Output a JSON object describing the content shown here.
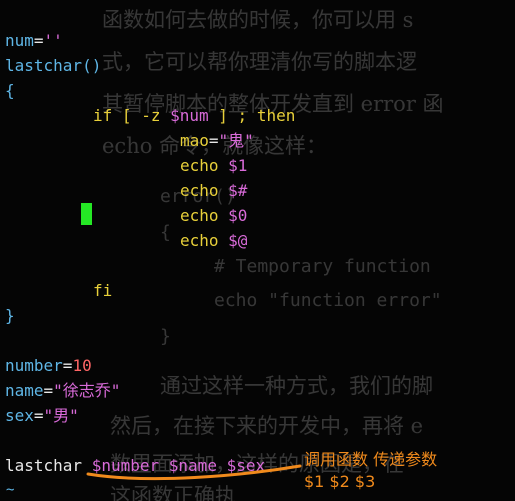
{
  "background_text": {
    "p1": "函数如何去做的时候，你可以用 s",
    "p2": "式，它可以帮你理清你写的脚本逻",
    "p3": "其暂停脚本的整体开发直到 error 函",
    "p4": "echo 命令，就像这样：",
    "c1": "error()",
    "c2": "{",
    "c3": "# Temporary function",
    "c4": "echo \"function error\"",
    "c5": "}",
    "p5": "通过这样一种方式，我们的脚",
    "p6": "然后，在接下来的开发中，再将 e",
    "p7": "数里面添加，这样的原因是，在",
    "p8": "这函数正确执"
  },
  "code": {
    "l1": {
      "name": "num",
      "eq": "=",
      "val": "''"
    },
    "l2": {
      "name": "lastchar()"
    },
    "l3": {
      "brace": "{"
    },
    "l4": {
      "if": "if",
      "open": "[",
      "flag": "-z",
      "var": "$num",
      "close": "]",
      "semi": ";",
      "then": "then"
    },
    "l5": {
      "name": "mao",
      "eq": "=",
      "val": "\"鬼\""
    },
    "l6": {
      "cmd": "echo",
      "arg": "$1"
    },
    "l7": {
      "cmd": "echo",
      "arg": "$#"
    },
    "l8": {
      "cmd": "echo",
      "arg": "$0"
    },
    "l9": {
      "cmd": "echo",
      "arg": "$@"
    },
    "l10": {
      "fi": "fi"
    },
    "l11": {
      "brace": "}"
    },
    "l12": {
      "name": "number",
      "eq": "=",
      "val": "10"
    },
    "l13": {
      "name": "name",
      "eq": "=",
      "val": "\"徐志乔\""
    },
    "l14": {
      "name": "sex",
      "eq": "=",
      "val": "\"男\""
    },
    "l15": {
      "call": "lastchar",
      "a1": "$number",
      "a2": "$name",
      "a3": "$sex"
    }
  },
  "annotations": {
    "call_note": "调用函数 传递参数",
    "args_note": "$1 $2 $3"
  },
  "colors": {
    "annotation": "#f08a1c",
    "cursor": "#25e825",
    "variable": "#5fb6e6",
    "keyword": "#e8d03a",
    "string": "#d96bd9"
  }
}
